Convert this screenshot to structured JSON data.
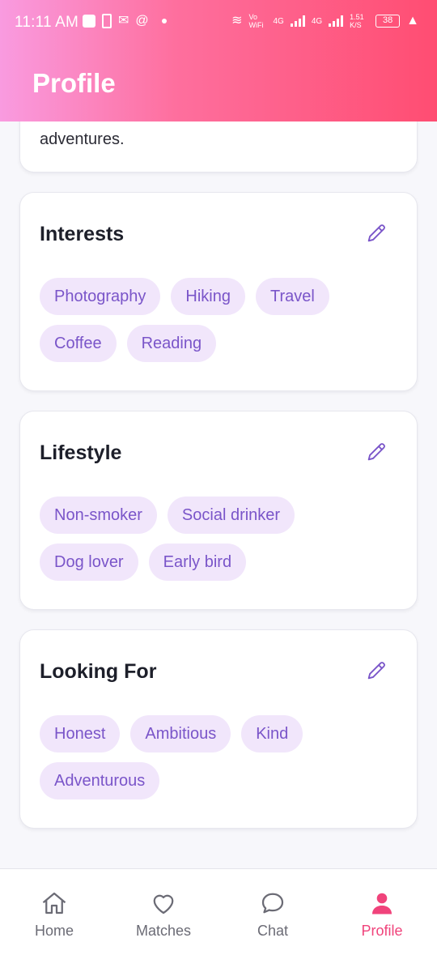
{
  "status_bar": {
    "time": "11:11 AM",
    "net1": "Vo WiFi",
    "net2": "4G",
    "net3": "4G",
    "speed": "1.51 K/S",
    "battery": "38"
  },
  "header": {
    "title": "Profile"
  },
  "about": {
    "text_tail": "adventures."
  },
  "sections": [
    {
      "title": "Interests",
      "chips": [
        "Photography",
        "Hiking",
        "Travel",
        "Coffee",
        "Reading"
      ]
    },
    {
      "title": "Lifestyle",
      "chips": [
        "Non-smoker",
        "Social drinker",
        "Dog lover",
        "Early bird"
      ]
    },
    {
      "title": "Looking For",
      "chips": [
        "Honest",
        "Ambitious",
        "Kind",
        "Adventurous"
      ]
    }
  ],
  "nav": [
    {
      "label": "Home",
      "icon": "home-icon"
    },
    {
      "label": "Matches",
      "icon": "heart-icon"
    },
    {
      "label": "Chat",
      "icon": "chat-icon"
    },
    {
      "label": "Profile",
      "icon": "person-icon",
      "active": true
    }
  ],
  "colors": {
    "accent": "#f0437b",
    "chip_bg": "#f1e6fb",
    "chip_text": "#7a55c9",
    "header_gradient": [
      "#f99be0",
      "#ff4d72"
    ]
  }
}
